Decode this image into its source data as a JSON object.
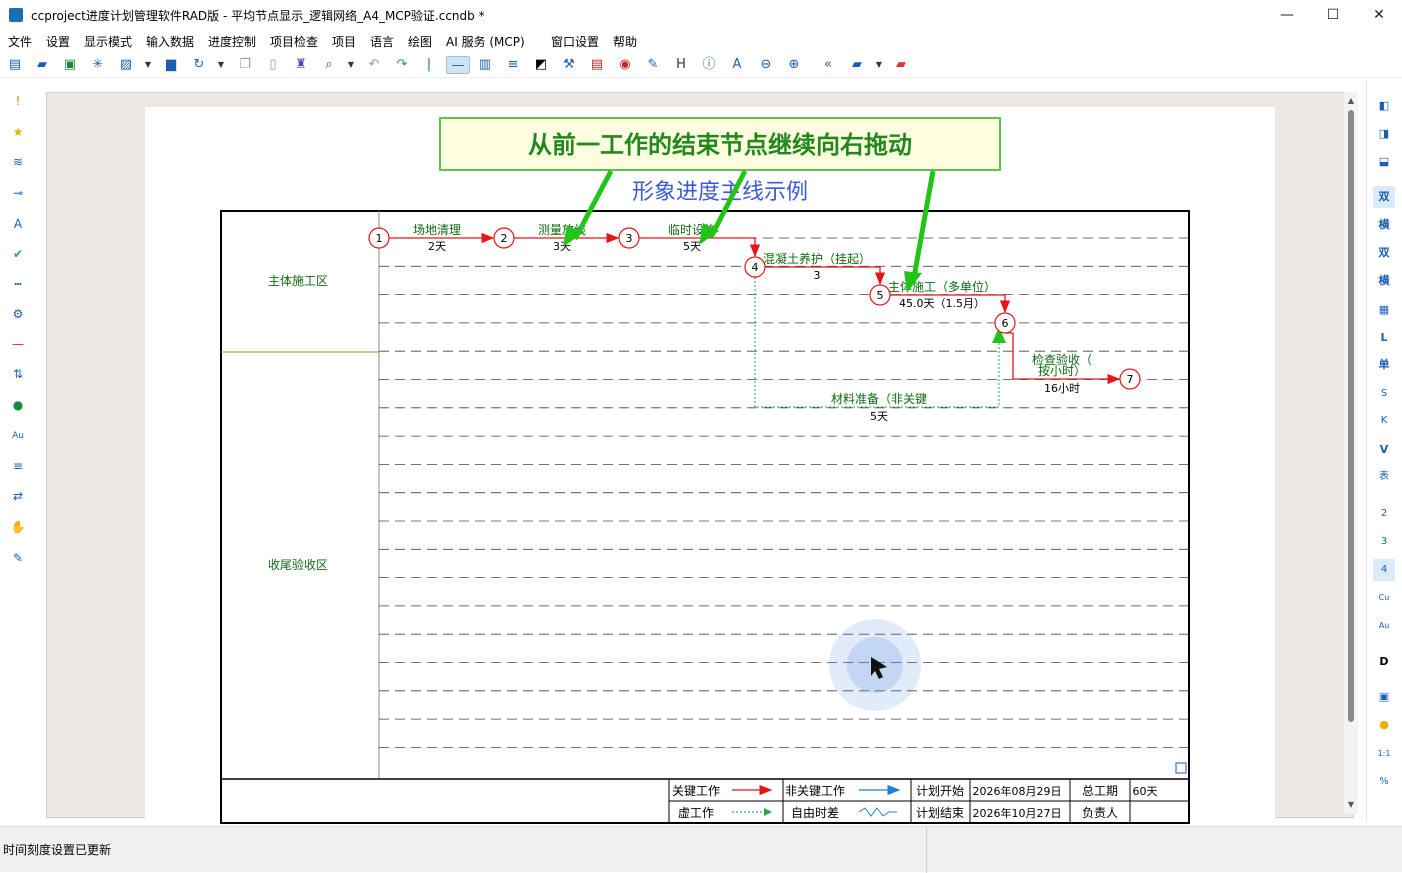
{
  "window": {
    "title": "ccproject进度计划管理软件RAD版 - 平均节点显示_逻辑网络_A4_MCP验证.ccndb *",
    "minimize": "—",
    "maximize": "☐",
    "close": "✕"
  },
  "menu": [
    "文件",
    "设置",
    "显示模式",
    "输入数据",
    "进度控制",
    "项目检查",
    "项目",
    "语言",
    "绘图",
    "AI 服务 (MCP)",
    "窗口设置",
    "帮助"
  ],
  "toolbar_icons": [
    "new-doc-icon",
    "open-folder-icon",
    "save-icon",
    "asterisk-icon",
    "image-icon",
    "print-icon",
    "refresh-icon",
    "copy-icon",
    "paste-icon",
    "brush-icon",
    "search-icon",
    "undo-icon",
    "redo-icon",
    "line-icon",
    "bar-icon",
    "sort-icon",
    "filter-icon",
    "tool-icon",
    "doc-icon",
    "palette-icon",
    "edit-icon",
    "h-icon",
    "info-icon",
    "a-icon",
    "zoom-out-icon",
    "zoom-in-icon",
    "back-icon",
    "folder-icon",
    "red-folder-icon"
  ],
  "callout": {
    "text": "从前一工作的结束节点继续向右拖动",
    "colors": {
      "fill": "#fdfde0",
      "border": "#5cc24a",
      "text": "#22881e",
      "arrow": "#22c41a"
    }
  },
  "diagram": {
    "title": "形象进度主线示例",
    "zones": [
      "主体施工区",
      "收尾验收区"
    ],
    "nodes": [
      "1",
      "2",
      "3",
      "4",
      "5",
      "6",
      "7"
    ],
    "tasks": [
      {
        "name": "场地清理",
        "duration": "2天"
      },
      {
        "name": "测量放线",
        "duration": "3天"
      },
      {
        "name": "临时设施",
        "duration": "5天"
      },
      {
        "name": "混凝土养护（挂起）",
        "duration": "3"
      },
      {
        "name": "主体施工（多单位）",
        "duration": "45.0天（1.5月）"
      },
      {
        "name_line1": "检查验收（",
        "name_line2": "按小时）",
        "duration": "16小时"
      },
      {
        "name": "材料准备（非关键",
        "duration": "5天"
      }
    ],
    "legend": {
      "critical": "关键工作",
      "noncritical": "非关键工作",
      "dummy": "虚工作",
      "free_float": "自由时差",
      "plan_start_label": "计划开始",
      "plan_start": "2026年08月29日",
      "plan_end_label": "计划结束",
      "plan_end": "2026年10月27日",
      "total_duration_label": "总工期",
      "total_duration": "60天",
      "owner_label": "负责人",
      "owner": ""
    },
    "colors": {
      "critical": "#e01818",
      "noncritical": "#1f7fd6",
      "dummy": "#2aa84a",
      "text": "#0f6a0f",
      "title": "#3b5bd6"
    }
  },
  "right_bar": [
    "layout-left-icon",
    "layout-right-icon",
    "layout-bottom-icon",
    "双",
    "横",
    "双",
    "横",
    "table-icon",
    "L",
    "单",
    "S",
    "K",
    "V",
    "表",
    "2",
    "3",
    "4",
    "Cu",
    "Au",
    "D",
    "calendar-icon",
    "comment-icon",
    "1:1",
    "%"
  ],
  "status": {
    "message": "时间刻度设置已更新"
  }
}
